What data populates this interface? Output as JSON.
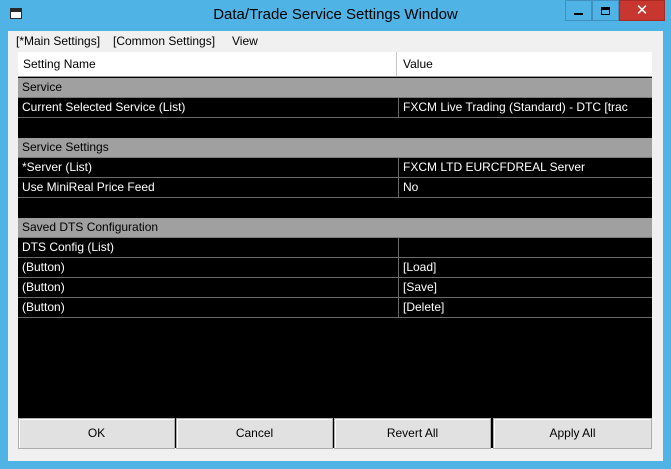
{
  "window": {
    "title": "Data/Trade Service Settings Window"
  },
  "menu": [
    "[*Main Settings]",
    "[Common Settings]",
    "View"
  ],
  "grid": {
    "columns": [
      "Setting Name",
      "Value"
    ],
    "rows": [
      {
        "kind": "section",
        "name": "Service",
        "value": ""
      },
      {
        "kind": "row",
        "name": "Current Selected Service (List)",
        "value": "FXCM Live Trading (Standard) - DTC    [trac"
      },
      {
        "kind": "spacer",
        "name": "",
        "value": ""
      },
      {
        "kind": "section",
        "name": "Service Settings",
        "value": ""
      },
      {
        "kind": "row",
        "name": "*Server (List)",
        "value": "FXCM LTD EURCFDREAL Server"
      },
      {
        "kind": "row",
        "name": "Use MiniReal Price Feed",
        "value": "No"
      },
      {
        "kind": "spacer",
        "name": "",
        "value": ""
      },
      {
        "kind": "section",
        "name": "Saved DTS Configuration",
        "value": ""
      },
      {
        "kind": "row",
        "name": "DTS Config (List)",
        "value": ""
      },
      {
        "kind": "row",
        "name": "(Button)",
        "value": "[Load]"
      },
      {
        "kind": "row",
        "name": "(Button)",
        "value": "[Save]"
      },
      {
        "kind": "row",
        "name": "(Button)",
        "value": "[Delete]"
      }
    ]
  },
  "buttons": {
    "ok": "OK",
    "cancel": "Cancel",
    "revert_all": "Revert All",
    "apply_all": "Apply All"
  },
  "icons": {
    "app": "window-icon",
    "minimize": "minimize-icon",
    "maximize": "maximize-icon",
    "close": "close-icon"
  },
  "colors": {
    "titlebar": "#4fb3e6",
    "close": "#c7372f",
    "section": "#a0a0a0",
    "grid_bg": "#000000"
  }
}
